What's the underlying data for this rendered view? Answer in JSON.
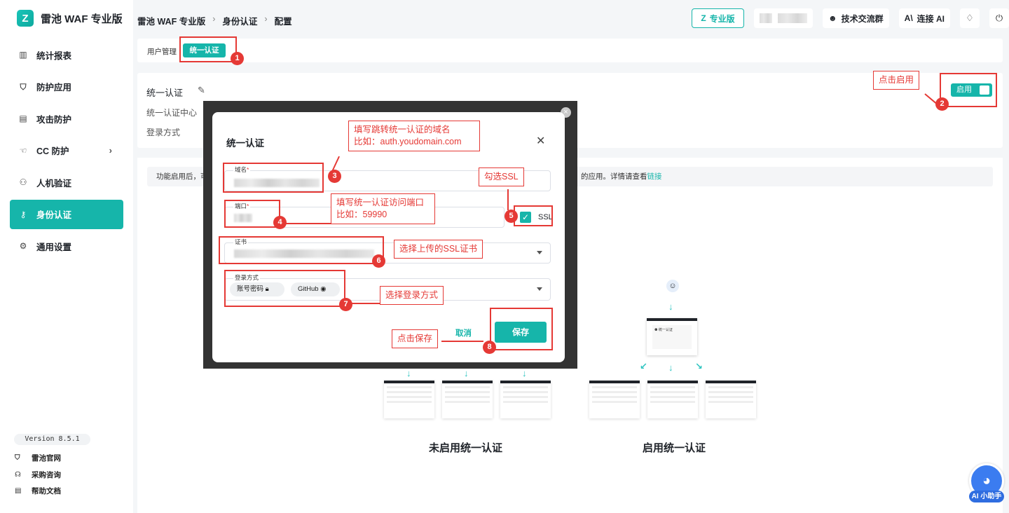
{
  "app": {
    "title": "雷池 WAF 专业版",
    "logo_mark": "Z"
  },
  "sidebar": {
    "items": [
      {
        "label": "统计报表",
        "icon": "bar-chart-icon",
        "glyph": "▥"
      },
      {
        "label": "防护应用",
        "icon": "shield-icon",
        "glyph": "⛉"
      },
      {
        "label": "攻击防护",
        "icon": "document-icon",
        "glyph": "▤"
      },
      {
        "label": "CC 防护",
        "icon": "hand-icon",
        "glyph": "☜",
        "chevron": "›"
      },
      {
        "label": "人机验证",
        "icon": "robot-icon",
        "glyph": "⚇"
      },
      {
        "label": "身份认证",
        "icon": "key-icon",
        "glyph": "⚷",
        "active": true
      },
      {
        "label": "通用设置",
        "icon": "gear-icon",
        "glyph": "⚙"
      }
    ],
    "version": "Version 8.5.1",
    "links": [
      {
        "label": "雷池官网",
        "icon": "shield-icon",
        "glyph": "⛉"
      },
      {
        "label": "采购咨询",
        "icon": "headset-icon",
        "glyph": "☊"
      },
      {
        "label": "帮助文档",
        "icon": "document-icon",
        "glyph": "▤"
      }
    ]
  },
  "header": {
    "breadcrumbs": [
      "雷池 WAF 专业版",
      "身份认证",
      "配置"
    ],
    "breadcrumb_sep": "›",
    "pro_label": "专业版",
    "pro_glyph": "Z",
    "community_label": "技术交流群",
    "community_glyph": "☻",
    "ai_label": "连接 AI",
    "ai_glyph": "A\\",
    "shirt_glyph": "♢",
    "logout_glyph": "⏻"
  },
  "tabs": {
    "items": [
      "用户管理",
      "统一认证"
    ],
    "active": "统一认证"
  },
  "auth_card": {
    "title": "统一认证",
    "edit_glyph": "✎",
    "field1": "统一认证中心",
    "field2": "登录方式",
    "toggle_label": "启用"
  },
  "info": {
    "text_left": "功能启用后，可",
    "text_right": "的应用。详情请查看",
    "link": "链接"
  },
  "diagram": {
    "left_label": "未启用统一认证",
    "right_label": "启用统一认证",
    "login_mini_title": "⚉ 统一认证",
    "avatar_glyph": "☺",
    "arrow_down": "↓",
    "arrow_left_down": "↙",
    "arrow_right_down": "↘"
  },
  "modal": {
    "title": "统一认证",
    "close_glyph": "✕",
    "outer_close_glyph": "×",
    "domain_label": "域名",
    "port_label": "端口",
    "required_mark": "*",
    "cert_label": "证书",
    "login_label": "登录方式",
    "ssl_label": "SSL",
    "ssl_checked": true,
    "check_glyph": "✓",
    "login_methods": [
      {
        "label": "账号密码",
        "glyph": "🔒︎"
      },
      {
        "label": "GitHub",
        "glyph": "◉"
      }
    ],
    "cancel_label": "取消",
    "save_label": "保存"
  },
  "annotations": {
    "n1": "1",
    "n2": "2",
    "n3": "3",
    "n4": "4",
    "n5": "5",
    "n6": "6",
    "n7": "7",
    "n8": "8",
    "enable": "点击启用",
    "domain_line1": "填写跳转统一认证的域名",
    "domain_line2": "比如：auth.youdomain.com",
    "port_line1": "填写统一认证访问端口",
    "port_line2": "比如：59990",
    "ssl": "勾选SSL",
    "cert": "选择上传的SSL证书",
    "login": "选择登录方式",
    "save": "点击保存"
  },
  "assistant": {
    "label": "AI 小助手",
    "glyph": "◕"
  },
  "colors": {
    "accent": "#16b5aa",
    "annotation": "#e53935"
  }
}
